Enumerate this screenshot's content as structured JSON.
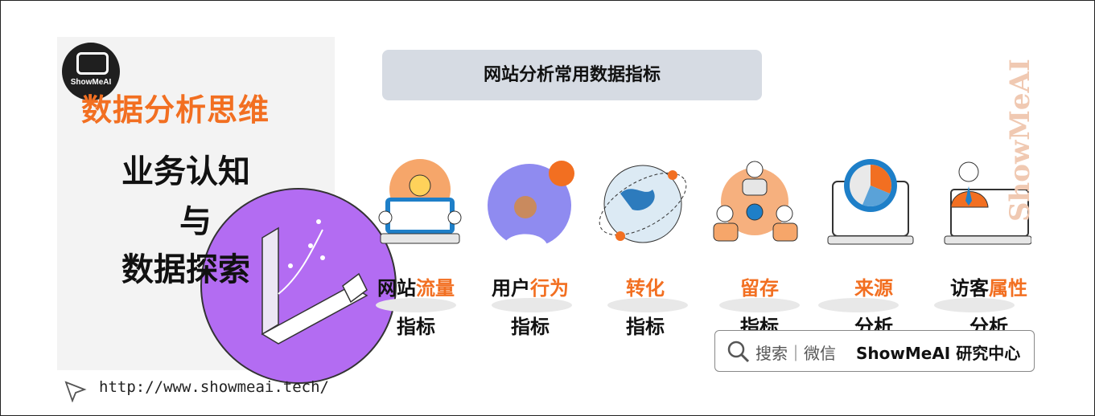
{
  "brand": {
    "logo_text": "ShowMeAI",
    "left_title": "数据分析思维",
    "subtitle_line1": "业务认知",
    "subtitle_line2": "与",
    "subtitle_line3": "数据探索",
    "watermark": "ShowMeAI"
  },
  "header": {
    "title": "网站分析常用数据指标"
  },
  "metrics": [
    {
      "label_plain": "网站",
      "label_accent": "流量",
      "line2": "指标",
      "icon": "lightbulb-laptop-icon"
    },
    {
      "label_plain": "用户",
      "label_accent": "行为",
      "line2": "指标",
      "icon": "user-avatar-icon"
    },
    {
      "label_plain": "",
      "label_accent": "转化",
      "line2": "指标",
      "icon": "globe-orbit-icon"
    },
    {
      "label_plain": "",
      "label_accent": "留存",
      "line2": "指标",
      "icon": "team-network-icon"
    },
    {
      "label_plain": "",
      "label_accent": "来源",
      "line2": "分析",
      "icon": "pie-chart-monitor-icon"
    },
    {
      "label_plain": "访客",
      "label_accent": "属性",
      "line2": "分析",
      "icon": "businessman-screen-icon"
    }
  ],
  "search": {
    "text": "搜索｜微信",
    "brand": "ShowMeAI 研究中心"
  },
  "footer": {
    "url": "http://www.showmeai.tech/"
  },
  "colors": {
    "accent": "#f26f21",
    "purple": "#b36cf2",
    "header_bg": "#d6dbe3"
  }
}
